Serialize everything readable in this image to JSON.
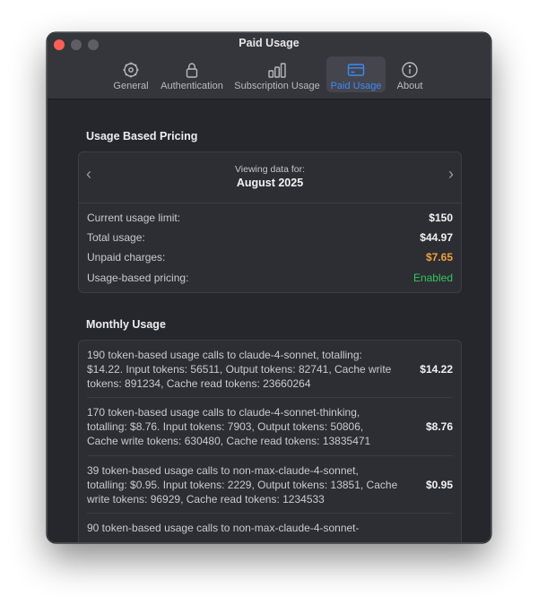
{
  "window": {
    "title": "Paid Usage"
  },
  "tabs": [
    {
      "label": "General",
      "icon": "gear-icon"
    },
    {
      "label": "Authentication",
      "icon": "lock-icon"
    },
    {
      "label": "Subscription Usage",
      "icon": "bar-chart-icon"
    },
    {
      "label": "Paid Usage",
      "icon": "credit-card-icon",
      "active": true
    },
    {
      "label": "About",
      "icon": "info-icon"
    }
  ],
  "pricing": {
    "heading": "Usage Based Pricing",
    "viewing_label": "Viewing data for:",
    "month": "August 2025",
    "rows": [
      {
        "label": "Current usage limit:",
        "value": "$150"
      },
      {
        "label": "Total usage:",
        "value": "$44.97"
      },
      {
        "label": "Unpaid charges:",
        "value": "$7.65"
      },
      {
        "label": "Usage-based pricing:",
        "value": "Enabled"
      }
    ]
  },
  "monthly": {
    "heading": "Monthly Usage",
    "items": [
      {
        "line1": "190 token-based usage calls to claude-4-sonnet, totalling:",
        "line2": "$14.22. Input tokens: 56511, Output tokens: 82741, Cache write",
        "line3": "tokens: 891234, Cache read tokens: 23660264",
        "amount": "$14.22"
      },
      {
        "line1": "170 token-based usage calls to claude-4-sonnet-thinking,",
        "line2": "totalling: $8.76. Input tokens: 7903, Output tokens: 50806,",
        "line3": "Cache write tokens: 630480, Cache read tokens: 13835471",
        "amount": "$8.76"
      },
      {
        "line1": "39 token-based usage calls to non-max-claude-4-sonnet,",
        "line2": "totalling: $0.95. Input tokens: 2229, Output tokens: 13851, Cache",
        "line3": "write tokens: 96929, Cache read tokens: 1234533",
        "amount": "$0.95"
      },
      {
        "line1": "90 token-based usage calls to non-max-claude-4-sonnet-"
      }
    ]
  },
  "colors": {
    "accent": "#3b8bf6",
    "unpaid": "#f0a23a",
    "enabled": "#34c759"
  }
}
